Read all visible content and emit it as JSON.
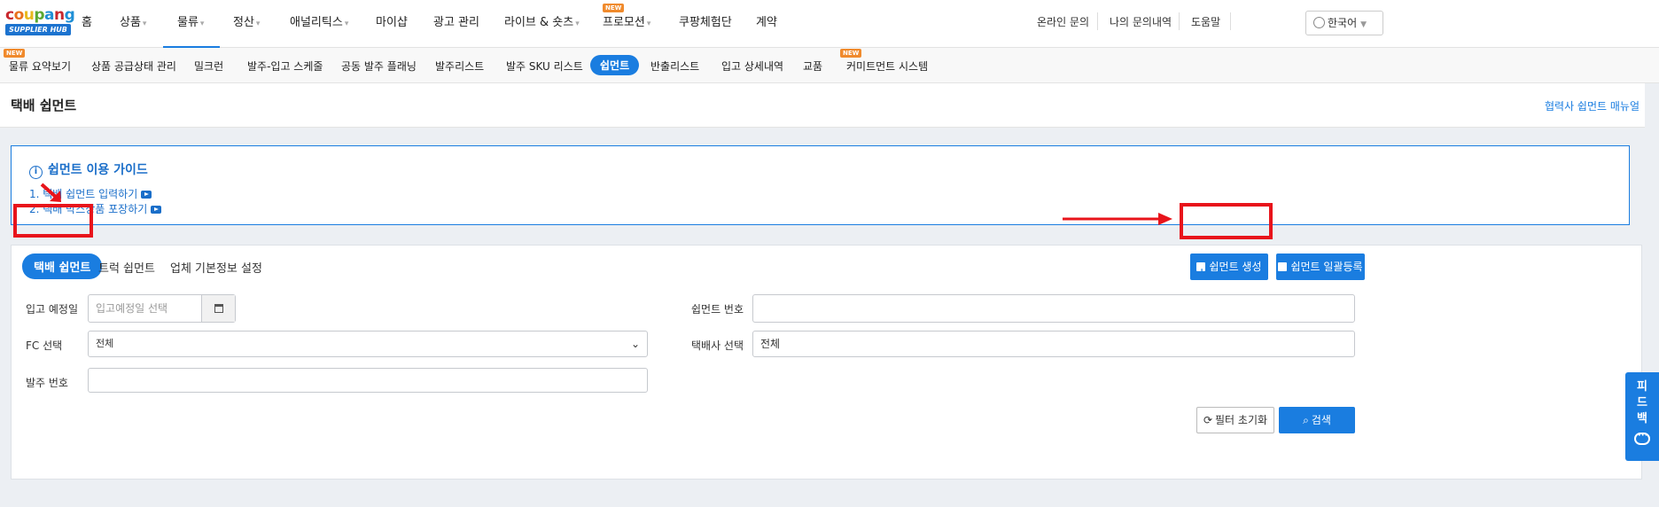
{
  "logo": {
    "wordmark": "coupang",
    "hub": "SUPPLIER HUB"
  },
  "topnav": {
    "items": [
      {
        "label": "홈"
      },
      {
        "label": "상품"
      },
      {
        "label": "물류"
      },
      {
        "label": "정산"
      },
      {
        "label": "애널리틱스"
      },
      {
        "label": "마이샵"
      },
      {
        "label": "광고 관리"
      },
      {
        "label": "라이브 & 숏츠"
      },
      {
        "label": "프로모션",
        "badge": "NEW"
      },
      {
        "label": "쿠팡체험단"
      },
      {
        "label": "계약"
      }
    ],
    "util_links": [
      "온라인 문의",
      "나의 문의내역",
      "도움말"
    ],
    "language": "한국어"
  },
  "subnav": {
    "items": [
      {
        "label": "물류 요약보기",
        "badge": "NEW"
      },
      {
        "label": "상품 공급상태 관리"
      },
      {
        "label": "밀크런"
      },
      {
        "label": "발주-입고 스케줄"
      },
      {
        "label": "공동 발주 플래닝"
      },
      {
        "label": "발주리스트"
      },
      {
        "label": "발주 SKU 리스트"
      },
      {
        "label": "쉽먼트"
      },
      {
        "label": "반출리스트"
      },
      {
        "label": "입고 상세내역"
      },
      {
        "label": "교품"
      },
      {
        "label": "커미트먼트 시스템",
        "badge": "NEW"
      }
    ]
  },
  "page": {
    "title": "택배 쉽먼트",
    "manual_link": "협력사 쉽먼트 매뉴얼"
  },
  "guide": {
    "title": "쉽먼트 이용 가이드",
    "links": [
      "1. 택배 쉽먼트 입력하기",
      "2. 택배 박스상품 포장하기"
    ]
  },
  "tabs": [
    "택배 쉽먼트",
    "트럭 쉽먼트",
    "업체 기본정보 설정"
  ],
  "actions": {
    "create": "쉽먼트 생성",
    "bulk": "쉽먼트 일괄등록"
  },
  "form": {
    "eta_label": "입고 예정일",
    "eta_placeholder": "입고예정일 선택",
    "shipment_no_label": "쉽먼트 번호",
    "shipment_no_value": "",
    "fc_label": "FC 선택",
    "fc_value": "전체",
    "courier_label": "택배사 선택",
    "courier_value": "전체",
    "po_label": "발주 번호",
    "po_value": ""
  },
  "buttons": {
    "reset": "필터 초기화",
    "search": "검색"
  },
  "feedback": {
    "label_1": "피",
    "label_2": "드",
    "label_3": "백"
  },
  "colors": {
    "accent": "#1a7de0",
    "highlight": "#e8141b",
    "new_badge": "#f08a2c"
  }
}
